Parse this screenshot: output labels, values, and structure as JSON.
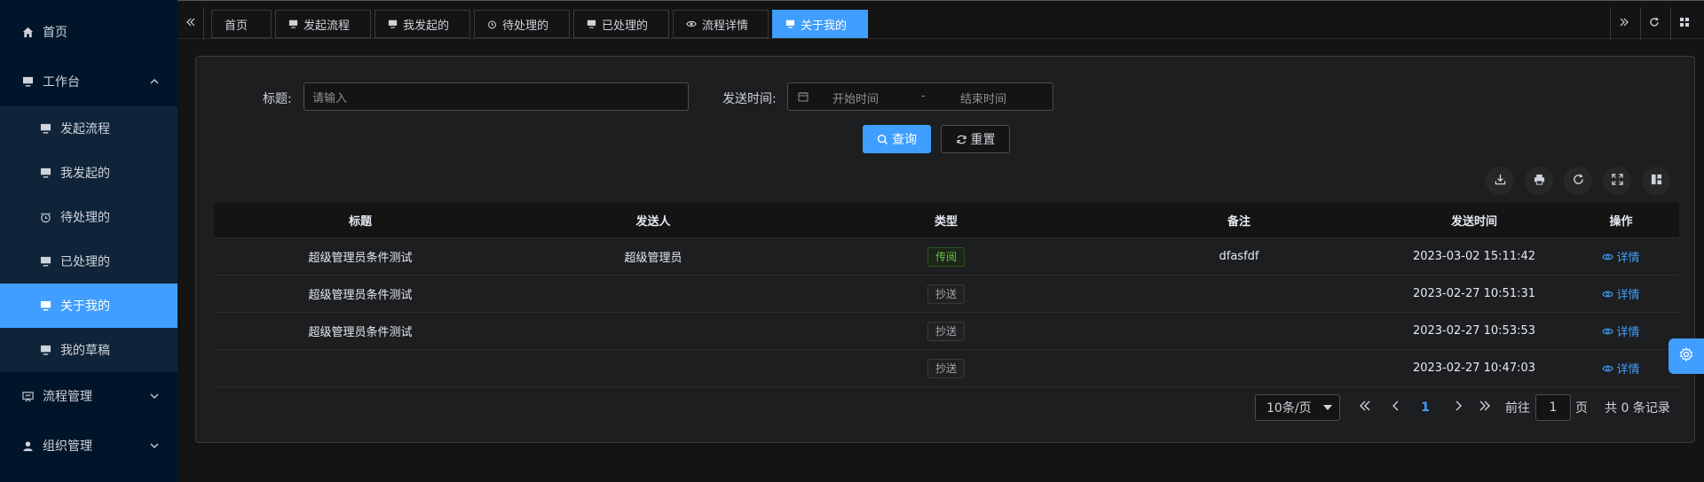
{
  "sidebar": {
    "home": "首页",
    "workbench": "工作台",
    "items": [
      {
        "label": "发起流程",
        "icon": "monitor-icon"
      },
      {
        "label": "我发起的",
        "icon": "monitor-icon"
      },
      {
        "label": "待处理的",
        "icon": "alarm-clock-icon"
      },
      {
        "label": "已处理的",
        "icon": "monitor-icon"
      },
      {
        "label": "关于我的",
        "icon": "monitor-icon"
      },
      {
        "label": "我的草稿",
        "icon": "monitor-icon"
      }
    ],
    "flow_manage": "流程管理",
    "org_manage": "组织管理"
  },
  "tabs": [
    {
      "label": "首页"
    },
    {
      "label": "发起流程"
    },
    {
      "label": "我发起的"
    },
    {
      "label": "待处理的"
    },
    {
      "label": "已处理的"
    },
    {
      "label": "流程详情"
    },
    {
      "label": "关于我的"
    }
  ],
  "search": {
    "title_label": "标题:",
    "title_placeholder": "请输入",
    "time_label": "发送时间:",
    "start_placeholder": "开始时间",
    "separator": "-",
    "end_placeholder": "结束时间",
    "query_btn": "查询",
    "reset_btn": "重置"
  },
  "table": {
    "headers": [
      "标题",
      "发送人",
      "类型",
      "备注",
      "发送时间",
      "操作"
    ],
    "rows": [
      {
        "title": "超级管理员条件测试",
        "sender": "超级管理员",
        "type": "传阅",
        "note": "dfasfdf",
        "time": "2023-03-02 15:11:42",
        "action": "详情"
      },
      {
        "title": "超级管理员条件测试",
        "sender": "",
        "type": "抄送",
        "note": "",
        "time": "2023-02-27 10:51:31",
        "action": "详情"
      },
      {
        "title": "超级管理员条件测试",
        "sender": "",
        "type": "抄送",
        "note": "",
        "time": "2023-02-27 10:53:53",
        "action": "详情"
      },
      {
        "title": "",
        "sender": "",
        "type": "抄送",
        "note": "",
        "time": "2023-02-27 10:47:03",
        "action": "详情"
      }
    ]
  },
  "pagination": {
    "page_size": "10条/页",
    "current_page": "1",
    "goto_prefix": "前往",
    "goto_value": "1",
    "goto_suffix": "页",
    "total": "共 0 条记录"
  },
  "colors": {
    "accent": "#409eff",
    "sidebar_bg": "#001529",
    "success": "#67c23a"
  }
}
